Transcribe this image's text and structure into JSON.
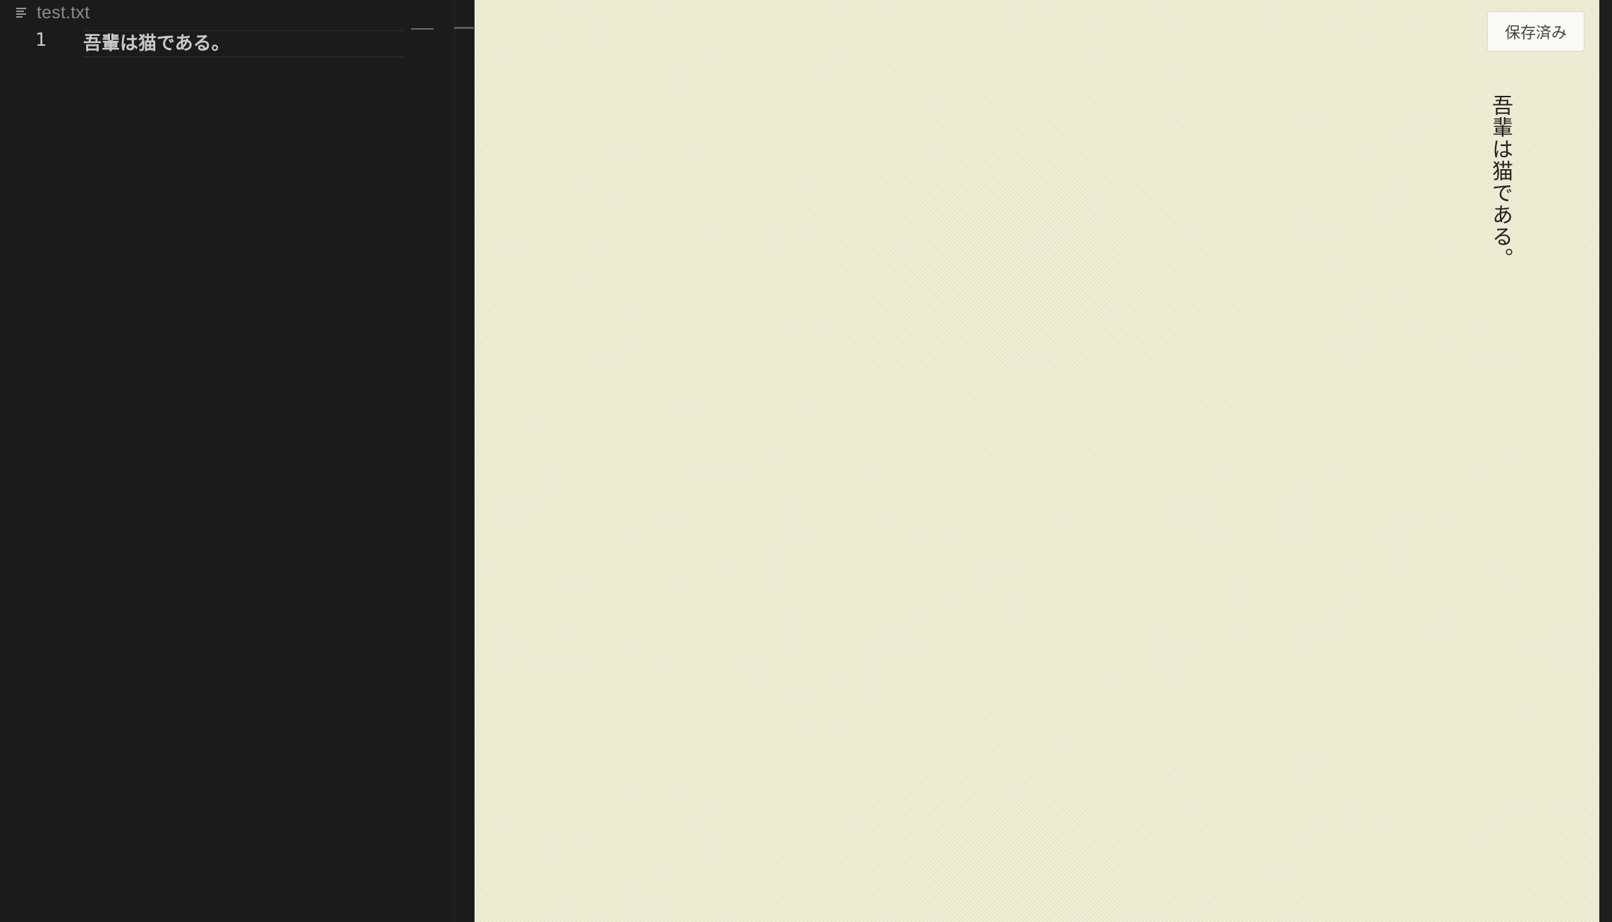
{
  "editor": {
    "tab": {
      "file_name": "test.txt",
      "icon": "lines-icon"
    },
    "lines": [
      {
        "number": "1",
        "text": "吾輩は猫である。"
      }
    ]
  },
  "preview": {
    "save_label": "保存済み",
    "vertical_text": "吾輩は猫である。"
  },
  "colors": {
    "editor_bg": "#1b1b1b",
    "preview_bg": "#efefd2",
    "text_light": "#c9c9c9",
    "text_dark": "#222222"
  }
}
